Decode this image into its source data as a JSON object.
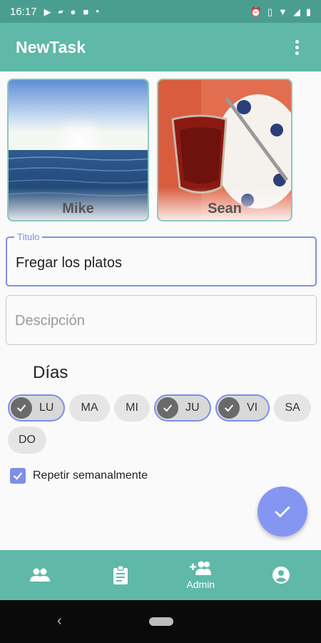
{
  "status_bar": {
    "time": "16:17",
    "left_icons": [
      "play-icon",
      "sim-icon",
      "android-icon",
      "square-icon",
      "dot-icon"
    ],
    "right_icons": [
      "alarm-icon",
      "vibrate-icon",
      "wifi-icon",
      "signal-icon",
      "battery-icon"
    ]
  },
  "app_bar": {
    "title": "NewTask"
  },
  "people": [
    {
      "name": "Mike",
      "image": "sea-sunset-photo"
    },
    {
      "name": "Sean",
      "image": "tea-glass-photo"
    }
  ],
  "title_field": {
    "label": "Titulo",
    "value": "Fregar los platos"
  },
  "description_field": {
    "placeholder": "Descipción"
  },
  "days": {
    "heading": "Días",
    "items": [
      {
        "label": "LU",
        "selected": true
      },
      {
        "label": "MA",
        "selected": false
      },
      {
        "label": "MI",
        "selected": false
      },
      {
        "label": "JU",
        "selected": true
      },
      {
        "label": "VI",
        "selected": true
      },
      {
        "label": "SA",
        "selected": false
      },
      {
        "label": "DO",
        "selected": false
      }
    ]
  },
  "repeat": {
    "label": "Repetir semanalmente",
    "checked": true
  },
  "fab": {
    "icon": "check-icon"
  },
  "bottom_nav": {
    "items": [
      {
        "icon": "people-icon",
        "label": ""
      },
      {
        "icon": "clipboard-icon",
        "label": ""
      },
      {
        "icon": "add-person-icon",
        "label": "Admin",
        "active": true
      },
      {
        "icon": "account-circle-icon",
        "label": ""
      }
    ]
  },
  "colors": {
    "primary": "#5fb8a8",
    "primary_dark": "#4a9e90",
    "accent": "#7f8ee8",
    "fab": "#8596f2"
  }
}
